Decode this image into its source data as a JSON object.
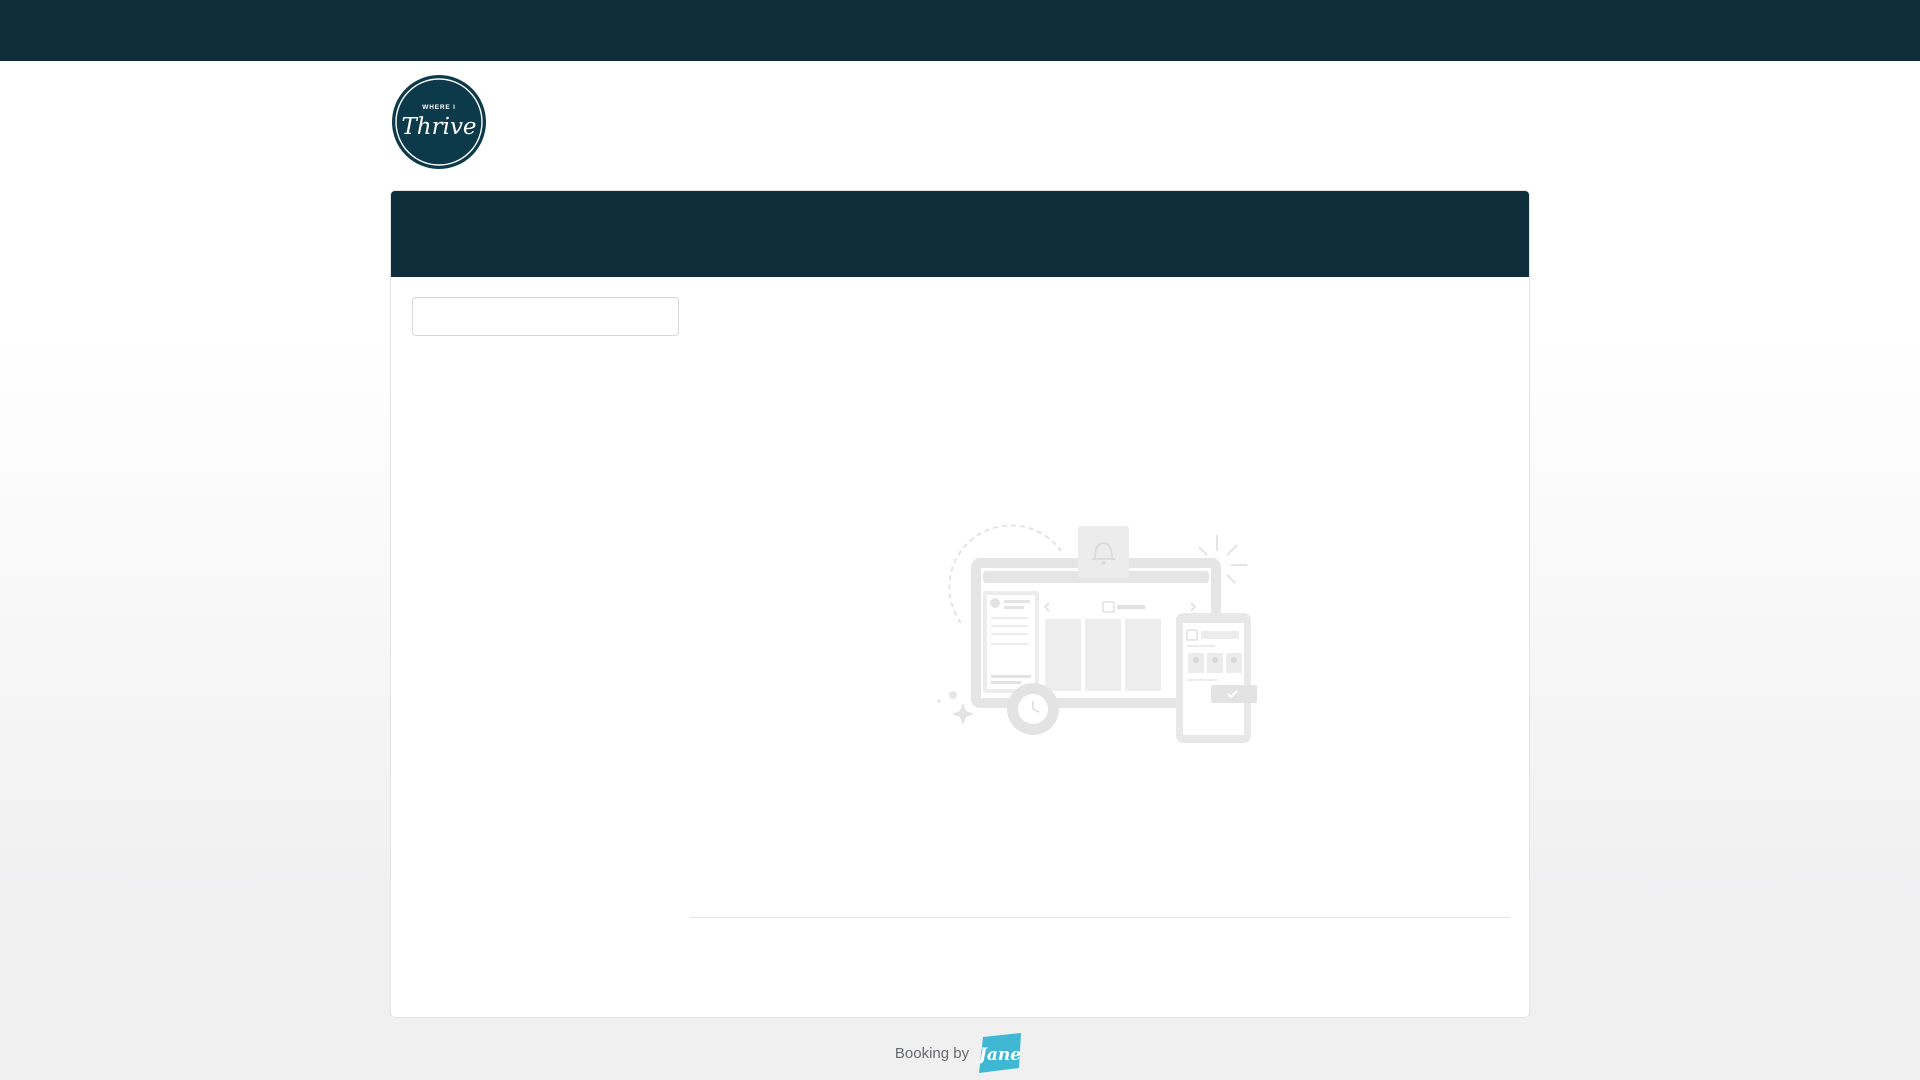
{
  "brand": {
    "logo_small_text": "WHERE I",
    "logo_script_text": "Thrive",
    "primary_color": "#0d2e3a"
  },
  "search": {
    "value": "",
    "placeholder": ""
  },
  "footer": {
    "booking_text": "Booking by",
    "jane_logo_text": "Jane",
    "jane_color": "#3fb8d4"
  },
  "icons": {
    "loading_illustration": "booking-calendar-illustration-icon"
  }
}
